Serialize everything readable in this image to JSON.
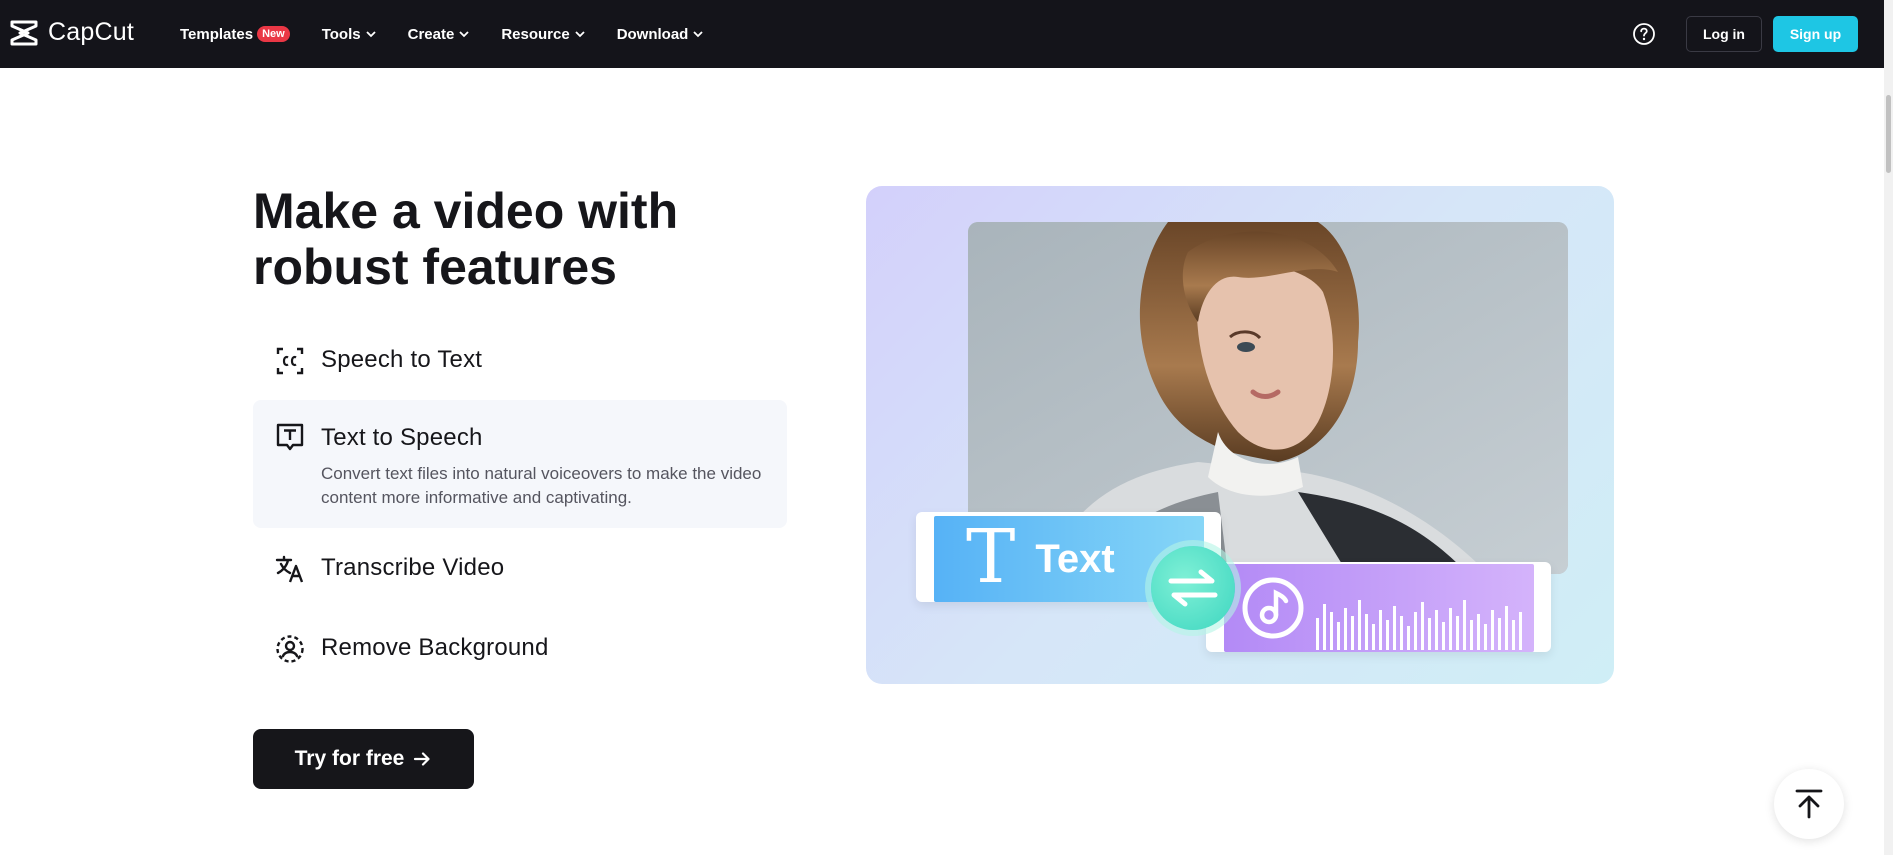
{
  "nav": {
    "logo_text": "CapCut",
    "items": [
      {
        "label": "Templates",
        "badge": "New"
      },
      {
        "label": "Tools"
      },
      {
        "label": "Create"
      },
      {
        "label": "Resource"
      },
      {
        "label": "Download"
      }
    ],
    "login_label": "Log in",
    "signup_label": "Sign up",
    "signup_color": "#1ec6e4"
  },
  "hero": {
    "headline": "Make a video with robust features",
    "features": [
      {
        "title": "Speech to Text",
        "icon": "closed-caption-icon"
      },
      {
        "title": "Text to Speech",
        "icon": "text-box-icon",
        "description": "Convert text files into natural voiceovers to make the video content more informative and captivating.",
        "active": true
      },
      {
        "title": "Transcribe Video",
        "icon": "translate-icon"
      },
      {
        "title": "Remove Background",
        "icon": "person-cutout-icon"
      }
    ],
    "cta_label": "Try for free"
  },
  "visual": {
    "text_chip_label": "Text"
  }
}
